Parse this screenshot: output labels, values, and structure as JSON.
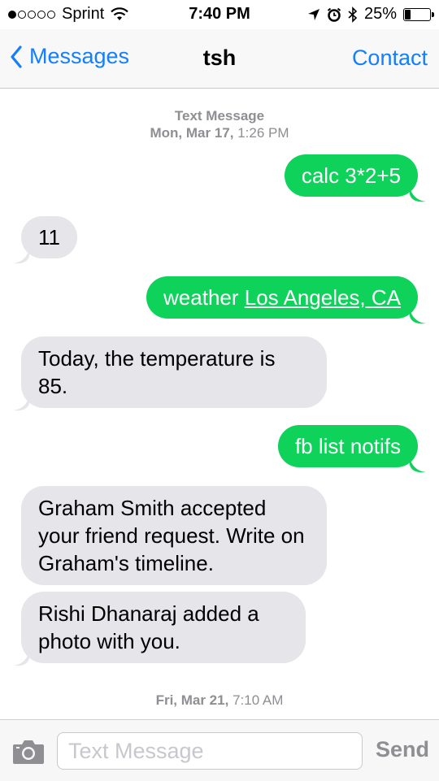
{
  "status_bar": {
    "carrier": "Sprint",
    "time": "7:40 PM",
    "battery": "25%",
    "signal_bars": 1,
    "battery_level": 0.25
  },
  "nav": {
    "back_label": "Messages",
    "title": "tsh",
    "contact_label": "Contact"
  },
  "stamps": [
    {
      "title": "Text Message",
      "day": "Mon, Mar 17,",
      "time": "1:26 PM"
    },
    {
      "day": "Fri, Mar 21,",
      "time": "7:10 AM"
    }
  ],
  "messages": [
    {
      "direction": "outgoing",
      "text": "calc 3*2+5"
    },
    {
      "direction": "incoming",
      "text": "11"
    },
    {
      "direction": "outgoing",
      "text": "weather ",
      "link": "Los Angeles, CA"
    },
    {
      "direction": "incoming",
      "text": "Today, the temperature is 85."
    },
    {
      "direction": "outgoing",
      "text": "fb list notifs"
    },
    {
      "direction": "incoming",
      "text": "Graham Smith accepted your friend request. Write on Graham's timeline."
    },
    {
      "direction": "incoming",
      "text": "Rishi Dhanaraj added a photo with you."
    }
  ],
  "input": {
    "placeholder": "Text Message",
    "value": "",
    "send_label": "Send"
  },
  "colors": {
    "accent": "#147efb",
    "outgoing_bubble": "#0fd25a",
    "incoming_bubble": "#e5e5ea"
  },
  "icons": [
    "signal-dots-icon",
    "wifi-icon",
    "location-arrow-icon",
    "alarm-clock-icon",
    "bluetooth-icon",
    "battery-icon",
    "back-chevron-icon",
    "camera-icon"
  ]
}
